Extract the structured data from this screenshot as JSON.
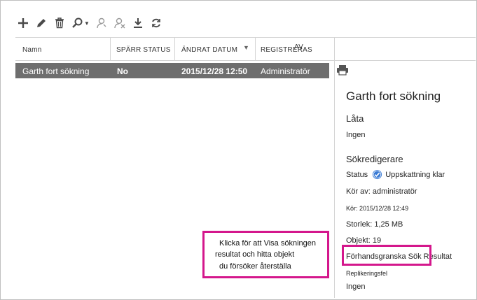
{
  "toolbar": {
    "icons": [
      "add-icon",
      "edit-icon",
      "delete-icon",
      "search-icon",
      "chevron-down-icon",
      "person-search-icon",
      "person-remove-icon",
      "download-icon",
      "refresh-icon"
    ]
  },
  "table": {
    "columns": [
      "Namn",
      "SPÄRR STATUS",
      "ÄNDRAT DATUM",
      "REGISTRERAS",
      "AV"
    ],
    "rows": [
      {
        "name": "Garth fort sökning",
        "lock_status": "No",
        "modified": "2015/12/28 12:50",
        "registered_by": "Administratör"
      }
    ]
  },
  "details": {
    "title": "Garth fort sökning",
    "section1": "Låta",
    "section1_value": "Ingen",
    "section2": "Sökredigerare",
    "status_label": "Status",
    "status_value": "Uppskattning klar",
    "run_by": "Kör av: administratör",
    "run_at": "Kör: 2015/12/28 12:49",
    "size": "Storlek: 1,25 MB",
    "objects": "Objekt: 19",
    "preview_link": "Förhandsgranska Sök Resultat",
    "replication_label": "Replikeringsfel",
    "replication_value": "Ingen"
  },
  "callout": {
    "line1": "Klicka för att Visa sökningen",
    "line2": "resultat och hitta objekt",
    "line3": "du försöker återställa"
  },
  "colors": {
    "selected_row": "#6e6e6e",
    "callout_border": "#d4178c",
    "status_check": "#3a7bd5"
  }
}
